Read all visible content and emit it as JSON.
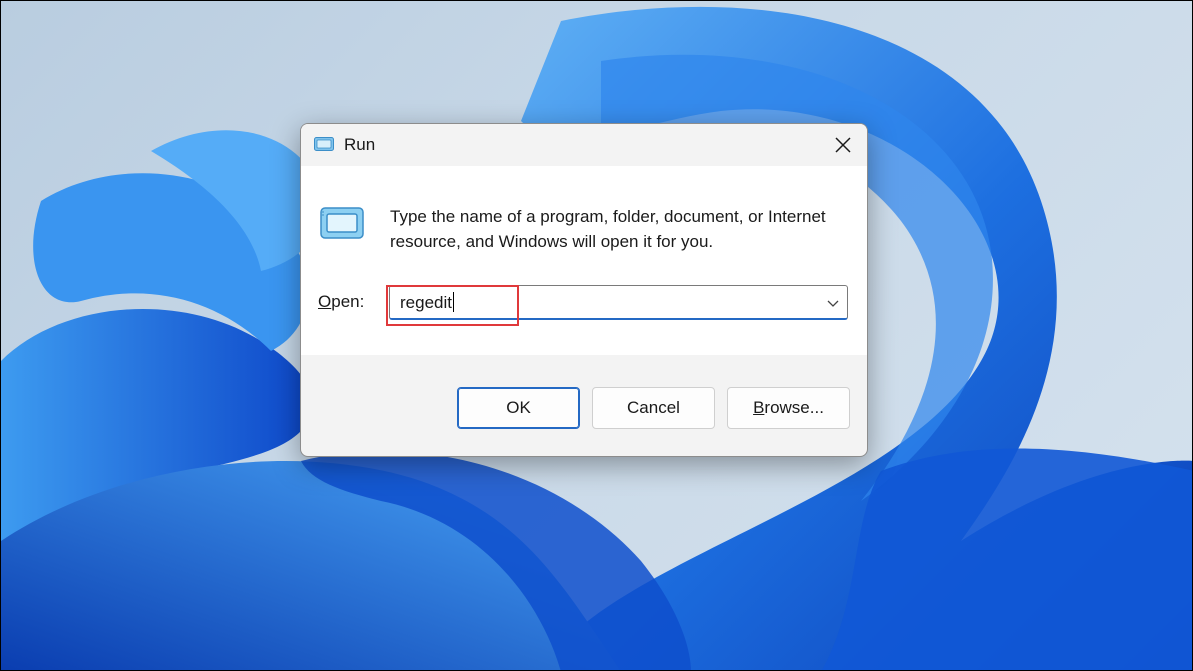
{
  "colors": {
    "accent": "#2469c4",
    "highlight_box": "#e0393b",
    "dialog_background": "#f3f3f3"
  },
  "dialog": {
    "title": "Run",
    "title_icon": "run-icon",
    "close_icon": "close-icon",
    "description": "Type the name of a program, folder, document, or Internet resource, and Windows will open it for you.",
    "open_label": "Open:",
    "open_label_accesskey": "O",
    "open_value": "regedit",
    "dropdown_icon": "chevron-down-icon",
    "buttons": {
      "ok": "OK",
      "cancel": "Cancel",
      "browse": "Browse..."
    }
  }
}
